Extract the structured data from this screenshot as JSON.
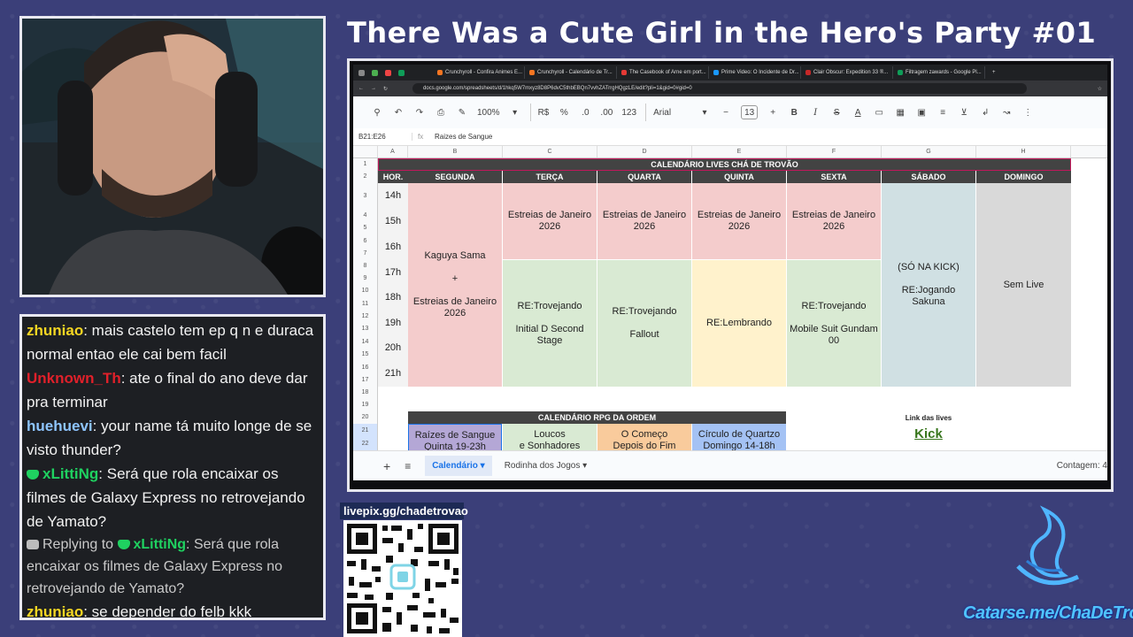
{
  "stream_title": "There Was a Cute Girl in the Hero's Party #01",
  "chat": [
    {
      "user": "zhuniao",
      "color": "#f5d623",
      "text": ": mais castelo tem ep q n e duraca normal entao ele cai bem facil",
      "badge": ""
    },
    {
      "user": "Unknown_Th",
      "color": "#e0202a",
      "text": ": ate o final do ano deve dar pra terminar",
      "badge": ""
    },
    {
      "user": "huehuevi",
      "color": "#8ec5ff",
      "text": ": your name tá muito longe de se visto thunder?",
      "badge": ""
    },
    {
      "user": "xLittiNg",
      "color": "#1fd160",
      "text": ": Será que rola encaixar os filmes de Galaxy Express no retrovejando de Yamato?",
      "badge": "gem"
    },
    {
      "prefix": "Replying to ",
      "user": "xLittiNg",
      "color": "#1fd160",
      "text": ": Será que rola encaixar os filmes de Galaxy Express no retrovejando de Yamato?",
      "badge": "reply"
    },
    {
      "user": "zhuniao",
      "color": "#f5d623",
      "text": ": se depender do felb kkk",
      "badge": ""
    }
  ],
  "browser": {
    "tabs": [
      "Crunchyroll - Confira Animes E...",
      "Crunchyroll - Calendário de Tr...",
      "The Casebook of Arne em port...",
      "Prime Video: O Incidente de Dr...",
      "Clair Obscur: Expedition 33 ®...",
      "Filtragem zawards - Google Pl..."
    ],
    "url": "docs.google.com/spreadsheets/d/1hkq5W7mxyz8D8P6dvC5thbEBQn7vvhZATrrgHQgzLE/edit?pli=1&gid=0#gid=0"
  },
  "toolbar": {
    "zoom": "100%",
    "currency": "R$",
    "percent": "%",
    "dec_minus": ".0",
    "dec_plus": ".00",
    "format123": "123",
    "font": "Arial",
    "font_size": "13"
  },
  "formula_bar": {
    "cell_ref": "B21:E26",
    "fx": "fx",
    "content": "Raizes de Sangue"
  },
  "columns": [
    "A",
    "B",
    "C",
    "D",
    "E",
    "F",
    "G",
    "H"
  ],
  "rows": [
    "1",
    "2",
    "3",
    "4",
    "5",
    "6",
    "7",
    "8",
    "9",
    "10",
    "11",
    "12",
    "13",
    "14",
    "15",
    "16",
    "17",
    "18",
    "19",
    "20",
    "21",
    "22"
  ],
  "sheet": {
    "main_title": "CALENDÁRIO LIVES CHÁ DE TROVÃO",
    "headers": [
      "HOR.",
      "SEGUNDA",
      "TERÇA",
      "QUARTA",
      "QUINTA",
      "SEXTA",
      "SÁBADO",
      "DOMINGO"
    ],
    "hours": [
      "14h",
      "15h",
      "16h",
      "17h",
      "18h",
      "19h",
      "20h",
      "21h"
    ],
    "segunda": "Kaguya Sama\n\n+\n\nEstreias de Janeiro\n2026",
    "estreias": "Estreias de Janeiro\n2026",
    "terca_b": "RE:Trovejando\n\nInitial D Second\nStage",
    "quarta_b": "RE:Trovejando\n\nFallout",
    "quinta_b": "RE:Lembrando",
    "sexta_b": "RE:Trovejando\n\nMobile Suit Gundam\n00",
    "sabado": "(SÓ NA KICK)\n\nRE:Jogando\nSakuna",
    "domingo": "Sem Live",
    "rpg_title": "CALENDÁRIO RPG DA ORDEM",
    "rpg": [
      "Raízes de Sangue\nQuinta 19-23h",
      "Loucos\ne Sonhadores",
      "O Começo\nDepois do Fim",
      "Círculo de Quartzo\nDomingo 14-18h"
    ],
    "link_label": "Link das lives",
    "link": "Kick"
  },
  "sheet_tabs": [
    "Calendário",
    "Rodinha dos Jogos"
  ],
  "status": "Contagem: 4",
  "qr_label": "livepix.gg/chadetrovao",
  "catarse": "Catarse.me/ChaDeTrovao",
  "colors": {
    "background": "#3b3f79",
    "pink": "#f4cccc",
    "green": "#d9ead3",
    "yellow": "#fff2cc",
    "blue_gray": "#d0e0e3",
    "header_dark": "#434343",
    "rpg_purple": "#b4a7d6",
    "rpg_orange": "#f9cb9c",
    "rpg_blue": "#a4c2f4",
    "link_green": "#38761d"
  }
}
